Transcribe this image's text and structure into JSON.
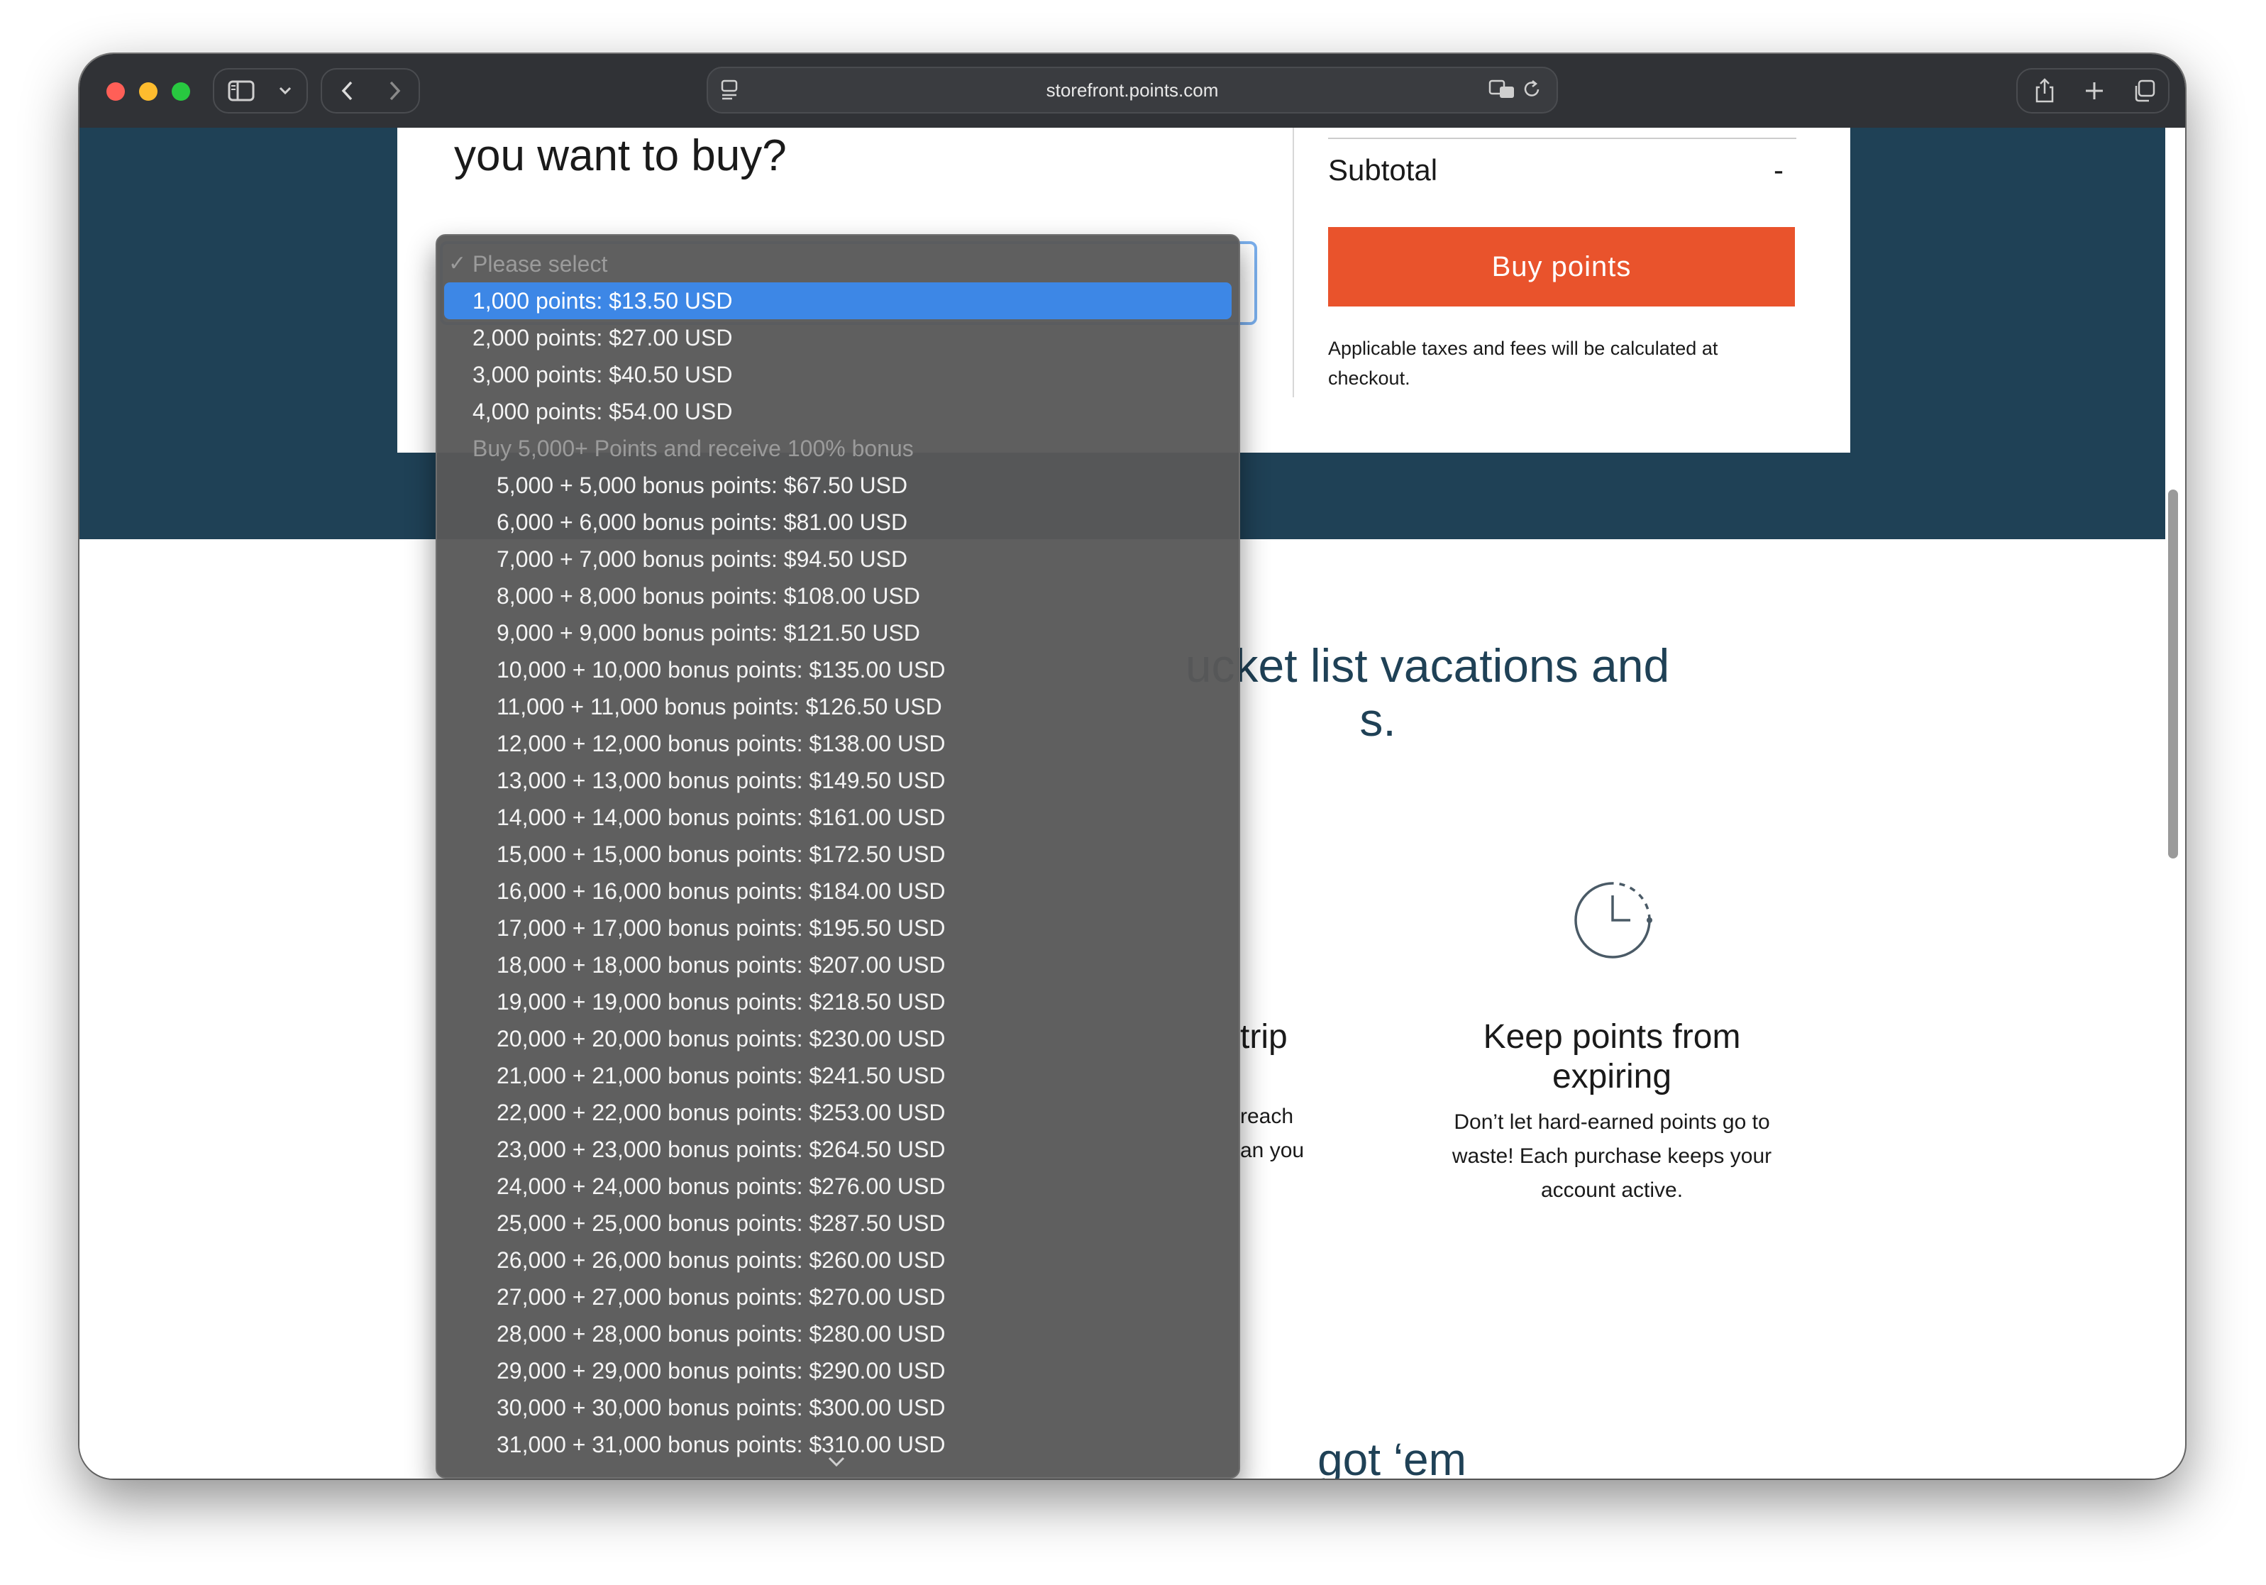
{
  "browser": {
    "url": "storefront.points.com",
    "icons": [
      "sidebar-icon",
      "chevron-down-icon",
      "back-icon",
      "forward-icon",
      "page-settings-icon",
      "translate-icon",
      "reload-icon",
      "share-icon",
      "new-tab-icon",
      "tab-overview-icon"
    ]
  },
  "card": {
    "title": "you want to buy?",
    "subtotal_label": "Subtotal",
    "subtotal_value": "-",
    "buy_button": "Buy points",
    "taxes_note": "Applicable taxes and fees will be calculated at checkout."
  },
  "section": {
    "heading": "ucket list vacations and",
    "heading_line2": "s.",
    "features": [
      {
        "title": "trip",
        "body_lines": [
          "reach",
          "an you"
        ]
      },
      {
        "title": "Keep points from expiring",
        "body": "Don’t let hard-earned points go to waste! Each purchase keeps your account active."
      }
    ],
    "bottom_heading": "got ‘em"
  },
  "dropdown": {
    "placeholder": "Please select",
    "group_label": "Buy 5,000+ Points and receive 100% bonus",
    "selected_index": 0,
    "top_options": [
      "1,000 points: $13.50 USD",
      "2,000 points: $27.00 USD",
      "3,000 points: $40.50 USD",
      "4,000 points: $54.00 USD"
    ],
    "bonus_options": [
      "5,000 + 5,000 bonus points: $67.50 USD",
      "6,000 + 6,000 bonus points: $81.00 USD",
      "7,000 + 7,000 bonus points: $94.50 USD",
      "8,000 + 8,000 bonus points: $108.00 USD",
      "9,000 + 9,000 bonus points: $121.50 USD",
      "10,000 + 10,000 bonus points: $135.00 USD",
      "11,000 + 11,000 bonus points: $126.50 USD",
      "12,000 + 12,000 bonus points: $138.00 USD",
      "13,000 + 13,000 bonus points: $149.50 USD",
      "14,000 + 14,000 bonus points: $161.00 USD",
      "15,000 + 15,000 bonus points: $172.50 USD",
      "16,000 + 16,000 bonus points: $184.00 USD",
      "17,000 + 17,000 bonus points: $195.50 USD",
      "18,000 + 18,000 bonus points: $207.00 USD",
      "19,000 + 19,000 bonus points: $218.50 USD",
      "20,000 + 20,000 bonus points: $230.00 USD",
      "21,000 + 21,000 bonus points: $241.50 USD",
      "22,000 + 22,000 bonus points: $253.00 USD",
      "23,000 + 23,000 bonus points: $264.50 USD",
      "24,000 + 24,000 bonus points: $276.00 USD",
      "25,000 + 25,000 bonus points: $287.50 USD",
      "26,000 + 26,000 bonus points: $260.00 USD",
      "27,000 + 27,000 bonus points: $270.00 USD",
      "28,000 + 28,000 bonus points: $280.00 USD",
      "29,000 + 29,000 bonus points: $290.00 USD",
      "30,000 + 30,000 bonus points: $300.00 USD",
      "31,000 + 31,000 bonus points: $310.00 USD"
    ]
  },
  "colors": {
    "hero": "#1f4156",
    "buy_button": "#e9532c",
    "selection": "#3d87e6"
  }
}
